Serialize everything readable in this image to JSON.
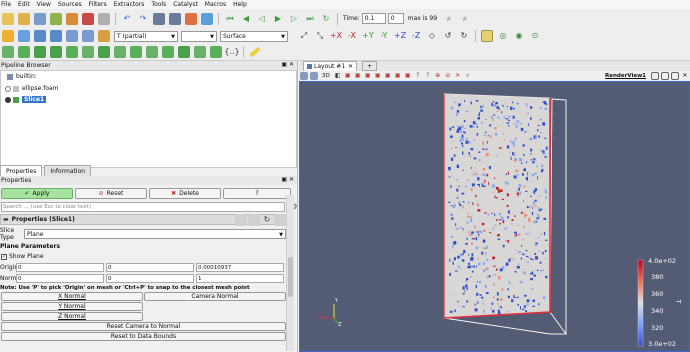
{
  "menu": [
    "File",
    "Edit",
    "View",
    "Sources",
    "Filters",
    "Extractors",
    "Tools",
    "Catalyst",
    "Macros",
    "Help"
  ],
  "time": {
    "label": "Time:",
    "value": "0.1",
    "step": "0",
    "max_label": "max is 99"
  },
  "toolbar2": {
    "color_by": "T (partial)",
    "component": "",
    "representation": "Surface"
  },
  "pipeline": {
    "title": "Pipeline Browser",
    "items": [
      "builtin:",
      "ellipse.foam",
      "Slice1"
    ]
  },
  "panel": {
    "tabs": [
      "Properties",
      "Information"
    ],
    "title": "Properties",
    "apply": "Apply",
    "reset": "Reset",
    "delete": "Delete",
    "help": "?",
    "search_placeholder": "Search ... (use Esc to clear text)",
    "section_title": "Properties (Slice1)",
    "slice_type_label": "Slice Type",
    "slice_type_value": "Plane",
    "plane_params": "Plane Parameters",
    "show_plane": "Show Plane",
    "origin_label": "Origin",
    "origin": [
      "0",
      "0",
      "0.00010937"
    ],
    "normal_label": "Normal",
    "normal": [
      "0",
      "0",
      "1"
    ],
    "note": "Note: Use 'P' to pick 'Origin' on mesh or 'Ctrl+P' to snap to the closest mesh point",
    "x_normal": "X Normal",
    "camera_normal": "Camera Normal",
    "y_normal": "Y Normal",
    "z_normal": "Z Normal",
    "reset_camera": "Reset Camera to Normal",
    "reset_bounds": "Reset to Data Bounds"
  },
  "layout": {
    "tab": "Layout #1",
    "add": "+",
    "view_name": "RenderView1",
    "mode": "3D"
  },
  "colorbar": {
    "title": "T",
    "labels": [
      "4.0e+02",
      "380",
      "360",
      "340",
      "320",
      "3.0e+02"
    ]
  },
  "axes": {
    "x": "X",
    "y": "Y",
    "z": "Z"
  },
  "colors": {
    "accent": "#3e65d0",
    "apply": "#a8e2a0",
    "background": "#545b74"
  }
}
